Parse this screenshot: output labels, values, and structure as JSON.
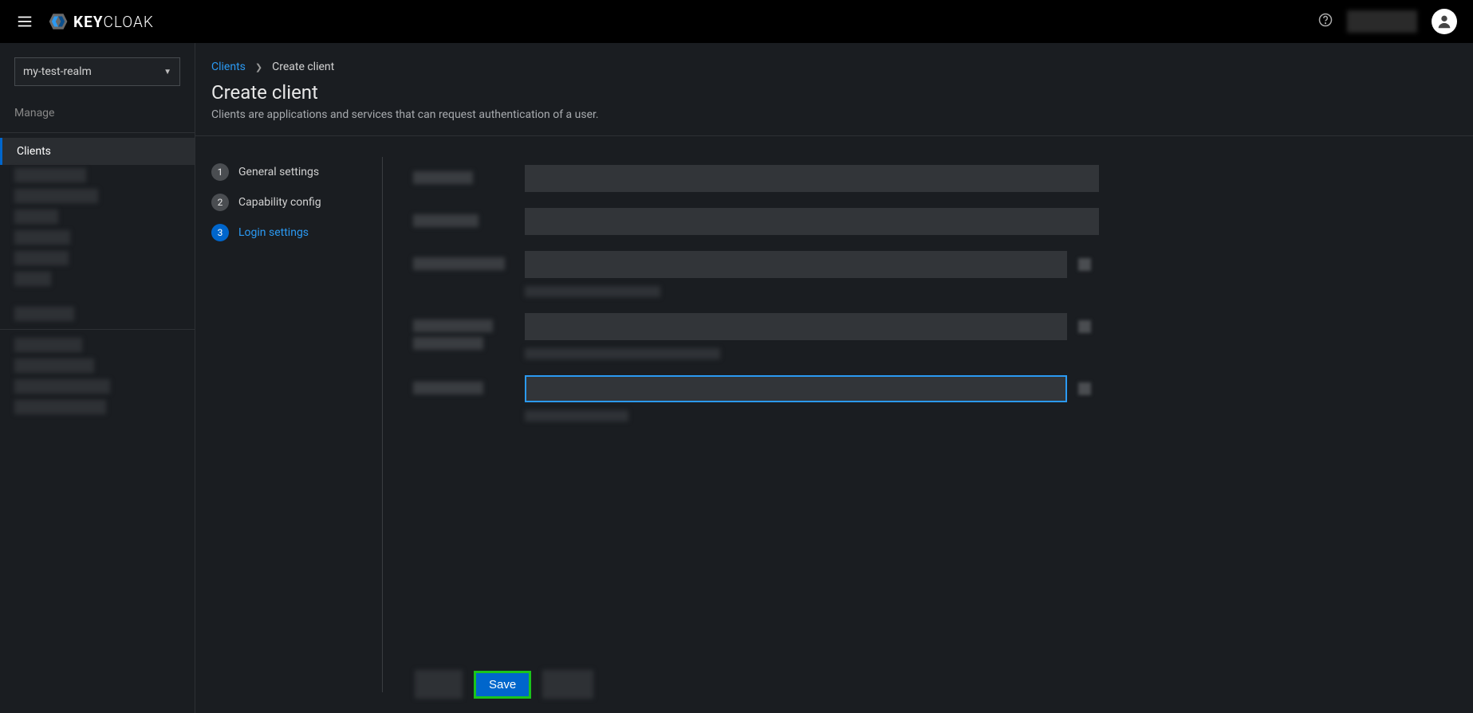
{
  "topbar": {
    "logo_text_a": "KEY",
    "logo_text_b": "CLOAK"
  },
  "realm_selector": {
    "selected": "my-test-realm"
  },
  "sidebar": {
    "section_label": "Manage",
    "clients_label": "Clients"
  },
  "breadcrumb": {
    "link": "Clients",
    "current": "Create client"
  },
  "page": {
    "title": "Create client",
    "description": "Clients are applications and services that can request authentication of a user."
  },
  "wizard": {
    "steps": [
      {
        "num": "1",
        "label": "General settings"
      },
      {
        "num": "2",
        "label": "Capability config"
      },
      {
        "num": "3",
        "label": "Login settings"
      }
    ],
    "active_index": 2
  },
  "actions": {
    "save": "Save"
  }
}
